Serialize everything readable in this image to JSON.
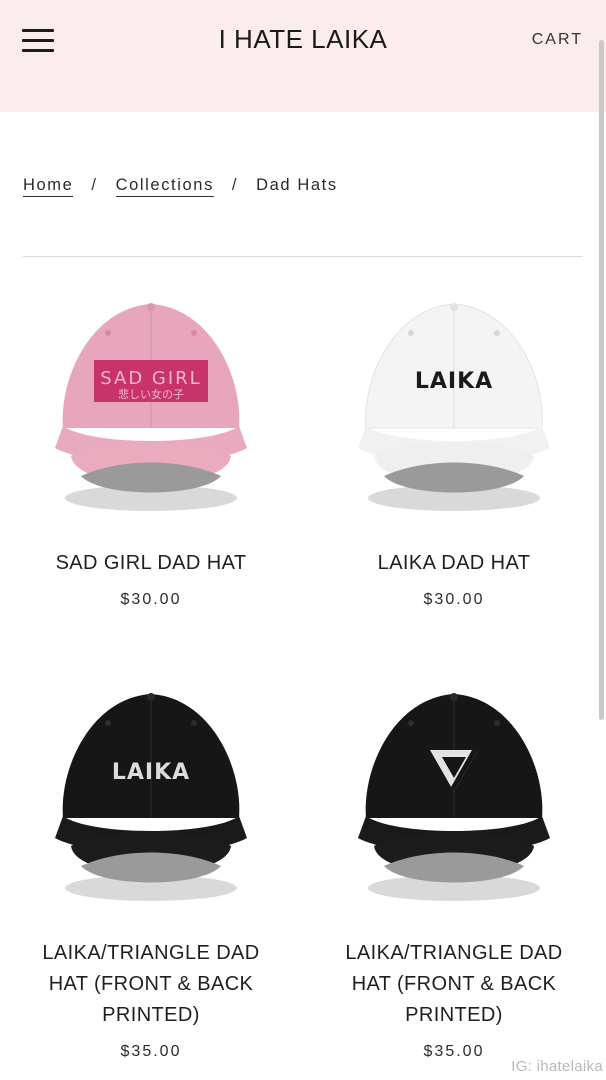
{
  "header": {
    "title": "I HATE LAIKA",
    "cart_label": "CART"
  },
  "breadcrumb": {
    "home": "Home",
    "collections": "Collections",
    "current": "Dad Hats",
    "separator": "/"
  },
  "products": [
    {
      "name": "SAD GIRL DAD HAT",
      "price": "$30.00",
      "hat_color": "#e7a6bb",
      "patch_color": "#c8336a",
      "logo_main": "SAD GIRL",
      "logo_sub": "悲しい女の子",
      "icon": "sad-girl-patch-icon"
    },
    {
      "name": "LAIKA DAD HAT",
      "price": "$30.00",
      "hat_color": "#f3f3f3",
      "logo_main": "LAIKA",
      "icon": "laika-logo-icon"
    },
    {
      "name": "LAIKA/TRIANGLE DAD HAT (FRONT & BACK PRINTED)",
      "price": "$35.00",
      "hat_color": "#161616",
      "logo_main": "LAIKA",
      "icon": "laika-logo-icon"
    },
    {
      "name": "LAIKA/TRIANGLE DAD HAT (FRONT & BACK PRINTED)",
      "price": "$35.00",
      "hat_color": "#161616",
      "icon": "triangle-logo-icon"
    }
  ],
  "watermark": "IG: ihatelaika"
}
